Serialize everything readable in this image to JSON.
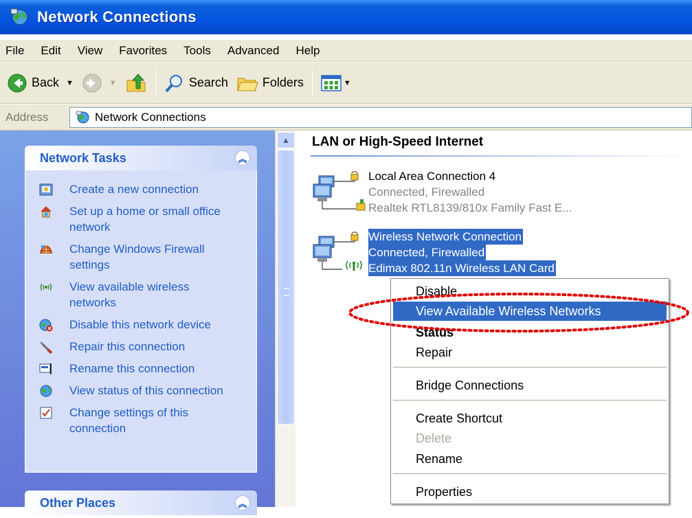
{
  "window": {
    "title": "Network Connections"
  },
  "menubar": [
    "File",
    "Edit",
    "View",
    "Favorites",
    "Tools",
    "Advanced",
    "Help"
  ],
  "toolbar": {
    "back": "Back",
    "search": "Search",
    "folders": "Folders"
  },
  "address": {
    "label": "Address",
    "value": "Network Connections"
  },
  "left_pane": {
    "network_tasks": {
      "title": "Network Tasks",
      "items": [
        {
          "label": "Create a new connection",
          "icon": "new-connection-icon"
        },
        {
          "label": "Set up a home or small office network",
          "icon": "home-network-icon"
        },
        {
          "label": "Change Windows Firewall settings",
          "icon": "firewall-icon"
        },
        {
          "label": "View available wireless networks",
          "icon": "wireless-icon"
        },
        {
          "label": "Disable this network device",
          "icon": "disable-device-icon"
        },
        {
          "label": "Repair this connection",
          "icon": "repair-icon"
        },
        {
          "label": "Rename this connection",
          "icon": "rename-icon"
        },
        {
          "label": "View status of this connection",
          "icon": "status-icon"
        },
        {
          "label": "Change settings of this connection",
          "icon": "settings-icon"
        }
      ]
    },
    "other_places": {
      "title": "Other Places"
    }
  },
  "content": {
    "group_header": "LAN or High-Speed Internet",
    "connections": [
      {
        "name": "Local Area Connection 4",
        "status": "Connected, Firewalled",
        "device": "Realtek RTL8139/810x Family Fast E..."
      },
      {
        "name": "Wireless Network Connection",
        "status": "Connected, Firewalled",
        "device": "Edimax 802.11n Wireless LAN Card"
      }
    ]
  },
  "context_menu": {
    "items": [
      "Disable",
      "View Available Wireless Networks",
      "Status",
      "Repair",
      "Bridge Connections",
      "Create Shortcut",
      "Delete",
      "Rename",
      "Properties"
    ],
    "highlighted": "View Available Wireless Networks",
    "default": "Status",
    "disabled": "Delete"
  },
  "colors": {
    "title_bar": "#0554e3",
    "selection": "#316ac5",
    "task_link": "#215dc6",
    "annotation": "#e00000"
  }
}
